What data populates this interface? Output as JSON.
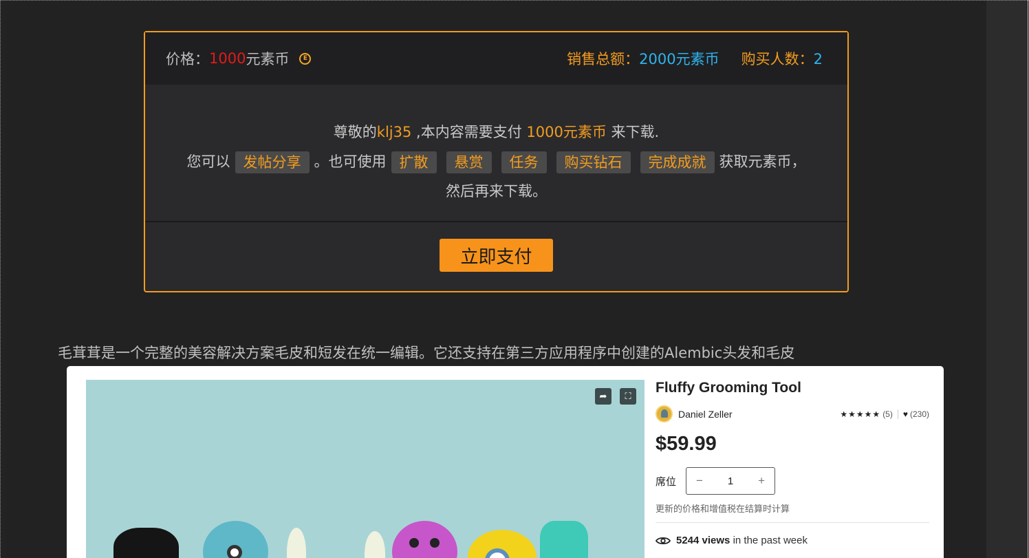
{
  "pay_box": {
    "price_label": "价格：",
    "price_value": "1000",
    "price_unit": "元素币",
    "coin_icon": "coin-icon",
    "sales_label": "销售总额：",
    "sales_value": "2000元素币",
    "buyers_label": "购买人数：",
    "buyers_value": "2",
    "line1_prefix": "尊敬的",
    "username": "klj35",
    "line1_mid": " ,本内容需要支付 ",
    "line1_amount": "1000元素币",
    "line1_suffix": " 来下载.",
    "line2_prefix": "您可以",
    "share_btn": "发帖分享",
    "line2_mid": "。也可使用",
    "tags": [
      "扩散",
      "悬赏",
      "任务",
      "购买钻石",
      "完成成就"
    ],
    "line2_suffix": "获取元素币，",
    "line3": "然后再来下载。",
    "pay_button": "立即支付"
  },
  "description": "毛茸茸是一个完整的美容解决方案毛皮和短发在统一编辑。它还支持在第三方应用程序中创建的Alembic头发和毛皮",
  "product": {
    "title": "Fluffy Grooming Tool",
    "author": "Daniel Zeller",
    "rating_count": "(5)",
    "likes": "(230)",
    "price": "$59.99",
    "qty_label": "席位",
    "qty_value": "1",
    "qty_minus": "−",
    "qty_plus": "+",
    "tax_note": "更新的价格和增值税在结算时计算",
    "views_count": "5244 views",
    "views_suffix": " in the past week",
    "share_icon": "share-icon",
    "fullscreen_icon": "fullscreen-icon"
  },
  "colors": {
    "accent_orange": "#f39c1f",
    "price_red": "#e31b1b",
    "stat_blue": "#2fb3ec"
  }
}
